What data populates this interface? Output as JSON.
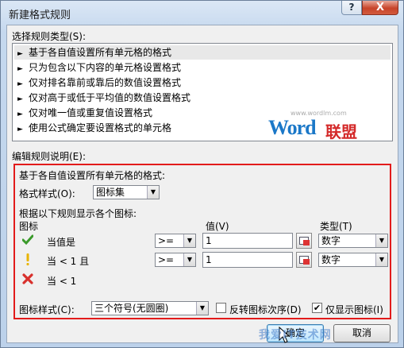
{
  "window": {
    "title": "新建格式规则",
    "help": "?",
    "close": "X"
  },
  "rule_type": {
    "label": "选择规则类型(S):",
    "items": [
      {
        "label": "基于各自值设置所有单元格的格式",
        "selected": true
      },
      {
        "label": "只为包含以下内容的单元格设置格式",
        "selected": false
      },
      {
        "label": "仅对排名靠前或靠后的数值设置格式",
        "selected": false
      },
      {
        "label": "仅对高于或低于平均值的数值设置格式",
        "selected": false
      },
      {
        "label": "仅对唯一值或重复值设置格式",
        "selected": false
      },
      {
        "label": "使用公式确定要设置格式的单元格",
        "selected": false
      }
    ]
  },
  "watermark": {
    "url": "www.wordlm.com",
    "word": "Word",
    "cn": "联盟"
  },
  "description": {
    "label": "编辑规则说明(E):",
    "heading": "基于各自值设置所有单元格的格式:",
    "format_style_label": "格式样式(O):",
    "format_style_value": "图标集",
    "rules_heading": "根据以下规则显示各个图标:",
    "col_icon": "图标",
    "col_value": "值(V)",
    "col_type": "类型(T)",
    "rows": [
      {
        "icon": "check-icon",
        "condition": "当值是",
        "operator": ">=",
        "value": "1",
        "type": "数字"
      },
      {
        "icon": "exclamation-icon",
        "condition": "当 < 1 且",
        "operator": ">=",
        "value": "1",
        "type": "数字"
      },
      {
        "icon": "cross-icon",
        "condition": "当 < 1"
      }
    ],
    "icon_style_label": "图标样式(C):",
    "icon_style_value": "三个符号(无圆圈)",
    "reverse_label": "反转图标次序(D)",
    "reverse_checked": false,
    "show_icon_only_label": "仅显示图标(I)",
    "show_icon_only_checked": true
  },
  "buttons": {
    "ok": "确定",
    "cancel": "取消"
  },
  "footer_watermark": "我爱IT技术网",
  "colors": {
    "highlight_border": "#e21b1b",
    "check": "#3a9a2a",
    "exclamation": "#e8b400",
    "cross": "#d8302c"
  }
}
